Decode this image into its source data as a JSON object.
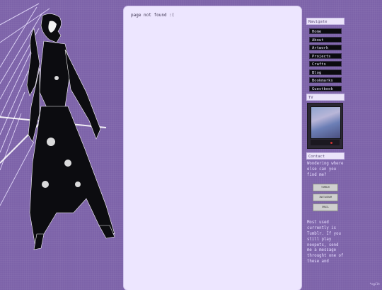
{
  "main": {
    "message": "page not found :("
  },
  "sidebar": {
    "navigate_header": "Navigate",
    "nav_items": [
      {
        "label": "Home"
      },
      {
        "label": "About"
      },
      {
        "label": "Artwork"
      },
      {
        "label": "Projects"
      },
      {
        "label": "Crafts"
      },
      {
        "label": "Blog"
      },
      {
        "label": "Bookmarks"
      },
      {
        "label": "Guestbook"
      }
    ],
    "tv_header": "TV",
    "contact_header": "Contact",
    "contact_text": "Wondering where else can you find me?",
    "contact_buttons": [
      {
        "label": "TUMBLR"
      },
      {
        "label": "INSTAGRAM"
      },
      {
        "label": "EMAIL"
      }
    ],
    "note_text": "Most used currently is Tumblr. If you still play neopets, send me a message throught one of these and"
  },
  "corner_text": "*cgilt",
  "colors": {
    "background": "#7d63a9",
    "panel": "#ede6ff",
    "nav_bg": "#0b0b0f"
  },
  "icons": {
    "illustration": "art-deco-woman-illustration"
  }
}
